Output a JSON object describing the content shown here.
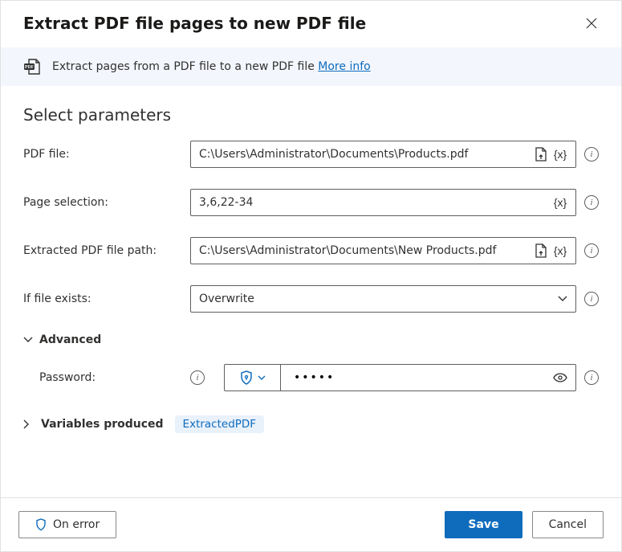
{
  "title": "Extract PDF file pages to new PDF file",
  "banner": {
    "text": "Extract pages from a PDF file to a new PDF file ",
    "more": "More info"
  },
  "section": "Select parameters",
  "labels": {
    "pdf_file": "PDF file:",
    "page_selection": "Page selection:",
    "extracted_path": "Extracted PDF file path:",
    "if_exists": "If file exists:",
    "advanced": "Advanced",
    "password": "Password:",
    "vars_produced": "Variables produced"
  },
  "values": {
    "pdf_file": "C:\\Users\\Administrator\\Documents\\Products.pdf",
    "page_selection": "3,6,22-34",
    "extracted_path": "C:\\Users\\Administrator\\Documents\\New Products.pdf",
    "if_exists": "Overwrite",
    "password": "•••••",
    "var_name": "ExtractedPDF"
  },
  "tokens": {
    "var": "{x}"
  },
  "buttons": {
    "on_error": "On error",
    "save": "Save",
    "cancel": "Cancel"
  }
}
